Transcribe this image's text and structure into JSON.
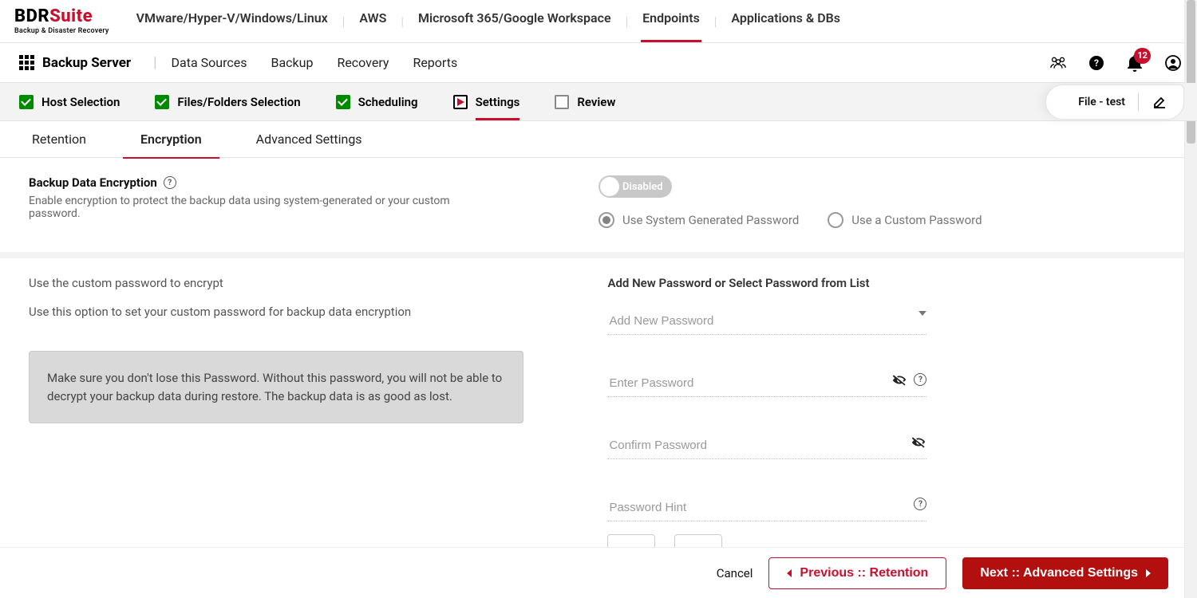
{
  "brand": {
    "name_a": "BDR",
    "name_b": "Suite",
    "tagline": "Backup & Disaster Recovery"
  },
  "productNav": {
    "items": [
      {
        "label": "VMware/Hyper-V/Windows/Linux"
      },
      {
        "label": "AWS"
      },
      {
        "label": "Microsoft 365/Google Workspace"
      },
      {
        "label": "Endpoints"
      },
      {
        "label": "Applications & DBs"
      }
    ],
    "activeIndex": 3
  },
  "contextBar": {
    "context": "Backup Server",
    "items": [
      {
        "label": "Data Sources"
      },
      {
        "label": "Backup"
      },
      {
        "label": "Recovery"
      },
      {
        "label": "Reports"
      }
    ],
    "notifications": "12"
  },
  "wizard": {
    "steps": [
      {
        "label": "Host Selection",
        "state": "done"
      },
      {
        "label": "Files/Folders Selection",
        "state": "done"
      },
      {
        "label": "Scheduling",
        "state": "done"
      },
      {
        "label": "Settings",
        "state": "current"
      },
      {
        "label": "Review",
        "state": "empty"
      }
    ],
    "jobName": "File - test"
  },
  "subTabs": {
    "items": [
      {
        "label": "Retention"
      },
      {
        "label": "Encryption"
      },
      {
        "label": "Advanced Settings"
      }
    ],
    "activeIndex": 1
  },
  "encryption": {
    "title": "Backup Data Encryption",
    "desc": "Enable encryption to protect the backup data using system-generated or your custom password.",
    "toggleLabel": "Disabled",
    "radioSystem": "Use System Generated Password",
    "radioCustom": "Use a Custom Password"
  },
  "customPw": {
    "leftTitle": "Use the custom password to encrypt",
    "leftDesc": "Use this option to set your custom password for backup data encryption",
    "warning": "Make sure you don't lose this Password. Without this password, you will not be able to decrypt your backup data during restore. The backup data is as good as lost.",
    "formTitle": "Add New Password or Select Password from List",
    "dropdownPlaceholder": "Add New Password",
    "enterPlaceholder": "Enter Password",
    "confirmPlaceholder": "Confirm Password",
    "hintPlaceholder": "Password Hint"
  },
  "footer": {
    "cancel": "Cancel",
    "prev": "Previous :: Retention",
    "next": "Next :: Advanced Settings"
  }
}
